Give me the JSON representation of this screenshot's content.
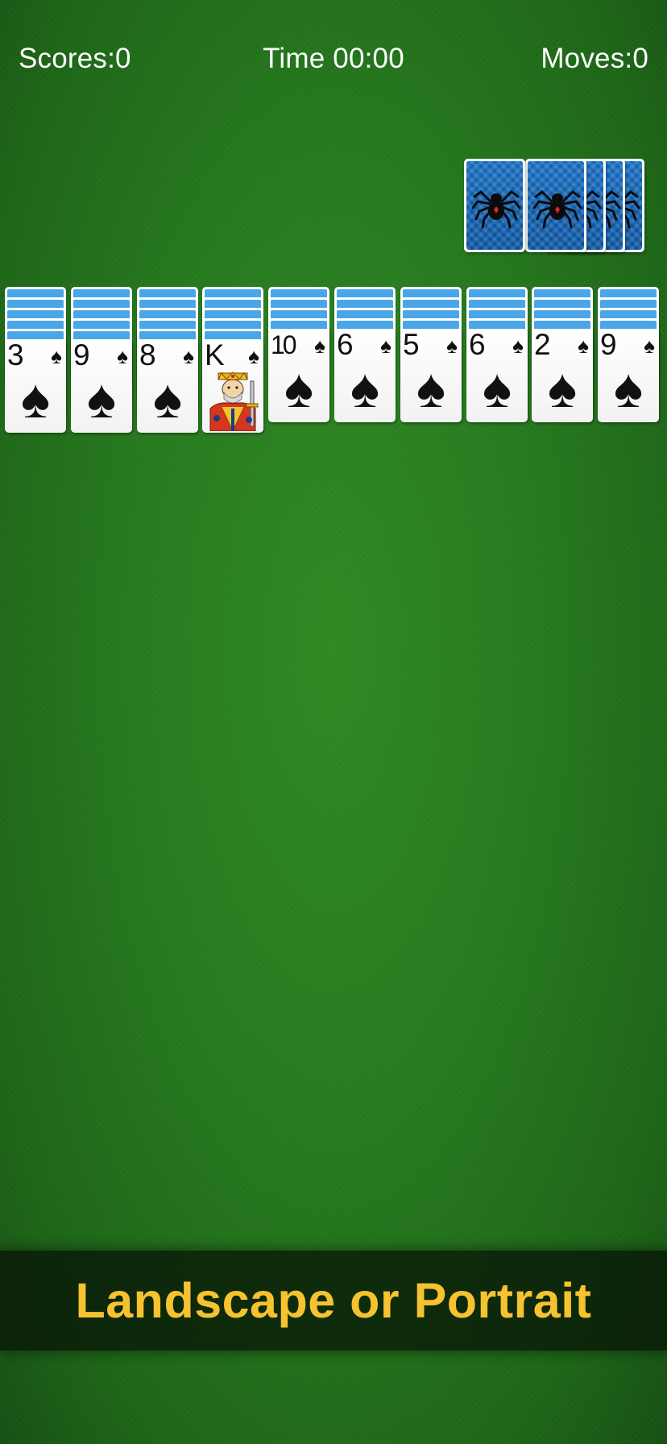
{
  "status": {
    "scores": "Scores:0",
    "time": "Time 00:00",
    "moves": "Moves:0"
  },
  "stock": {
    "card_back_icon": "spider-icon",
    "count_visible": 5
  },
  "tableau": {
    "suit_symbol": "♠",
    "columns": [
      {
        "rank": "3",
        "facedown": 5
      },
      {
        "rank": "9",
        "facedown": 5
      },
      {
        "rank": "8",
        "facedown": 5
      },
      {
        "rank": "K",
        "facedown": 5,
        "face_card": true
      },
      {
        "rank": "10",
        "facedown": 4
      },
      {
        "rank": "6",
        "facedown": 4
      },
      {
        "rank": "5",
        "facedown": 4
      },
      {
        "rank": "6",
        "facedown": 4
      },
      {
        "rank": "2",
        "facedown": 4
      },
      {
        "rank": "9",
        "facedown": 4
      }
    ]
  },
  "banner": {
    "text": "Landscape or Portrait"
  },
  "colors": {
    "felt": "#25791c",
    "banner_text": "#f6c230",
    "card_back": "#1a74c9",
    "facedown_stripe": "#4aa6e8"
  }
}
